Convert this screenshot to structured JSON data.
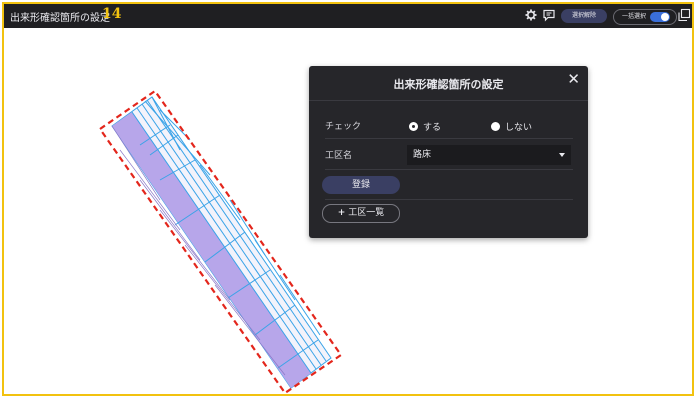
{
  "header": {
    "title": "出来形確認箇所の設定",
    "page_number": "14",
    "settings_icon": "gear-icon",
    "comment_icon": "comment-icon",
    "deselect_label": "選択解除",
    "multi_select_label": "一括選択",
    "multi_select_on": true,
    "copy_icon": "copy-icon"
  },
  "dialog": {
    "title": "出来形確認箇所の設定",
    "close_icon": "close-icon",
    "check_label": "チェック",
    "check_options": [
      "する",
      "しない"
    ],
    "check_selected": "する",
    "section_label": "工区名",
    "section_value": "路床",
    "register_label": "登録",
    "list_label": "工区一覧"
  },
  "colors": {
    "frame": "#f2c20f",
    "topbar": "#1f1f22",
    "dialog_bg": "#26262a",
    "mesh_fill": "#b7a6ea",
    "mesh_line": "#3aa3e8",
    "selection_dash": "#e3261c"
  }
}
